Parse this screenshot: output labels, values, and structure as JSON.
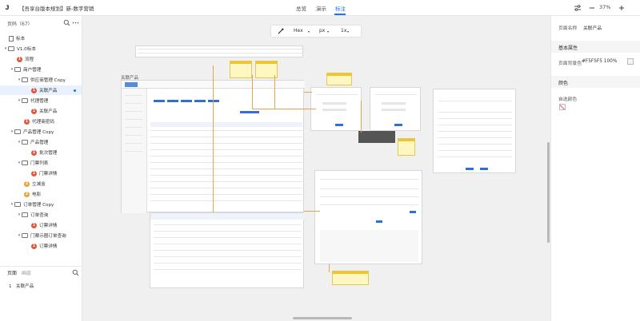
{
  "app": {
    "title": "【吾享台版本规划】新-数字营销"
  },
  "nav": {
    "tabs": [
      "总览",
      "演示",
      "标注"
    ],
    "active": "标注"
  },
  "toolbar": {
    "zoom": "37%"
  },
  "left_panel": {
    "header": "页码（67）",
    "tree": [
      {
        "label": "标本",
        "type": "page",
        "indent": 0
      },
      {
        "label": "V1.0标本",
        "type": "folder",
        "indent": 0
      },
      {
        "label": "流程",
        "type": "badge",
        "badge": "1",
        "indent": 1
      },
      {
        "label": "商户管理",
        "type": "folder",
        "indent": 1
      },
      {
        "label": "供应商管理 Copy",
        "type": "folder",
        "indent": 2
      },
      {
        "label": "关联产品",
        "type": "badge",
        "badge": "1",
        "indent": 3,
        "selected": true
      },
      {
        "label": "代理管理",
        "type": "folder",
        "indent": 2
      },
      {
        "label": "关联产品",
        "type": "badge",
        "badge": "1",
        "indent": 3
      },
      {
        "label": "代理商密码",
        "type": "badge",
        "badge": "1",
        "indent": 2
      },
      {
        "label": "产品管理 Copy",
        "type": "folder",
        "indent": 1
      },
      {
        "label": "产品管理",
        "type": "folder",
        "indent": 2
      },
      {
        "label": "批次管理",
        "type": "badge",
        "badge": "1",
        "indent": 3
      },
      {
        "label": "门票列表",
        "type": "folder",
        "indent": 2
      },
      {
        "label": "门票详情",
        "type": "badge",
        "badge": "1",
        "indent": 3
      },
      {
        "label": "立减金",
        "type": "badge",
        "badge": "2",
        "indent": 2,
        "orange": true
      },
      {
        "label": "电影",
        "type": "badge",
        "badge": "2",
        "indent": 2,
        "orange": true
      },
      {
        "label": "订单管理 Copy",
        "type": "folder",
        "indent": 1
      },
      {
        "label": "订单查询",
        "type": "folder",
        "indent": 2
      },
      {
        "label": "订票详情",
        "type": "badge",
        "badge": "1",
        "indent": 3
      },
      {
        "label": "门票示圈订单查询",
        "type": "folder",
        "indent": 2
      },
      {
        "label": "订票详情",
        "type": "badge",
        "badge": "1",
        "indent": 3
      }
    ],
    "bottom_tabs": [
      "页面",
      "画层"
    ],
    "pages": [
      {
        "num": "1",
        "label": "关联产品"
      }
    ]
  },
  "canvas": {
    "format_toolbar": {
      "format": "Hex",
      "unit": "px",
      "scale": "1x"
    },
    "artboard_label": "关联产品"
  },
  "right_panel": {
    "name_label": "页面名称",
    "name_value": "关联产品",
    "basic_section": "基本属性",
    "bg_label": "页面背景色",
    "bg_value": "#F5F5F5 100%",
    "color_section": "颜色",
    "own_color_label": "自选颜色"
  },
  "colors": {
    "accent": "#1e6fff",
    "badge_red": "#e5533d",
    "badge_orange": "#f0a030"
  },
  "icons": [
    "logo-icon",
    "sliders-icon",
    "zoom-out-icon",
    "zoom-in-icon",
    "search-icon",
    "more-icon",
    "eyedropper-icon"
  ]
}
